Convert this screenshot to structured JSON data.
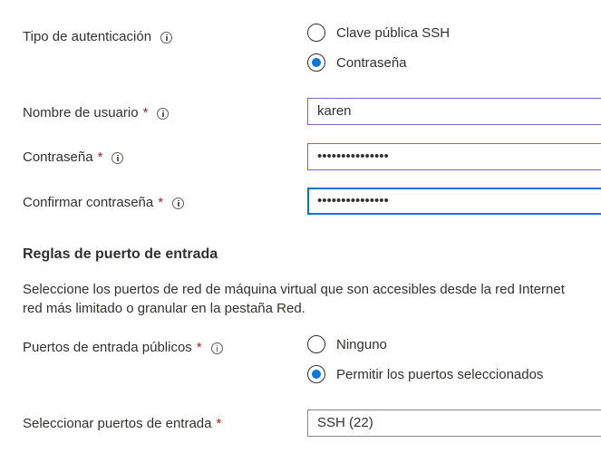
{
  "auth": {
    "label": "Tipo de autenticación",
    "options": [
      "Clave pública SSH",
      "Contraseña"
    ],
    "selected": "Contraseña"
  },
  "username": {
    "label": "Nombre de usuario",
    "required_mark": "*",
    "value": "karen"
  },
  "password": {
    "label": "Contraseña",
    "required_mark": "*",
    "value": "•••••••••••••••"
  },
  "confirm_password": {
    "label": "Confirmar contraseña",
    "required_mark": "*",
    "value": "•••••••••••••••"
  },
  "inbound": {
    "title": "Reglas de puerto de entrada",
    "description_line1": "Seleccione los puertos de red de máquina virtual que son accesibles desde la red Internet",
    "description_line2": "red más limitado o granular en la pestaña Red.",
    "public_ports": {
      "label": "Puertos de entrada públicos",
      "required_mark": "*",
      "options": [
        "Ninguno",
        "Permitir los puertos seleccionados"
      ],
      "selected": "Permitir los puertos seleccionados"
    },
    "select_ports": {
      "label": "Seleccionar puertos de entrada",
      "required_mark": "*",
      "value": "SSH (22)"
    }
  },
  "colors": {
    "accent": "#0078d4",
    "required": "#a4262c",
    "input_border": "#8764b8"
  }
}
